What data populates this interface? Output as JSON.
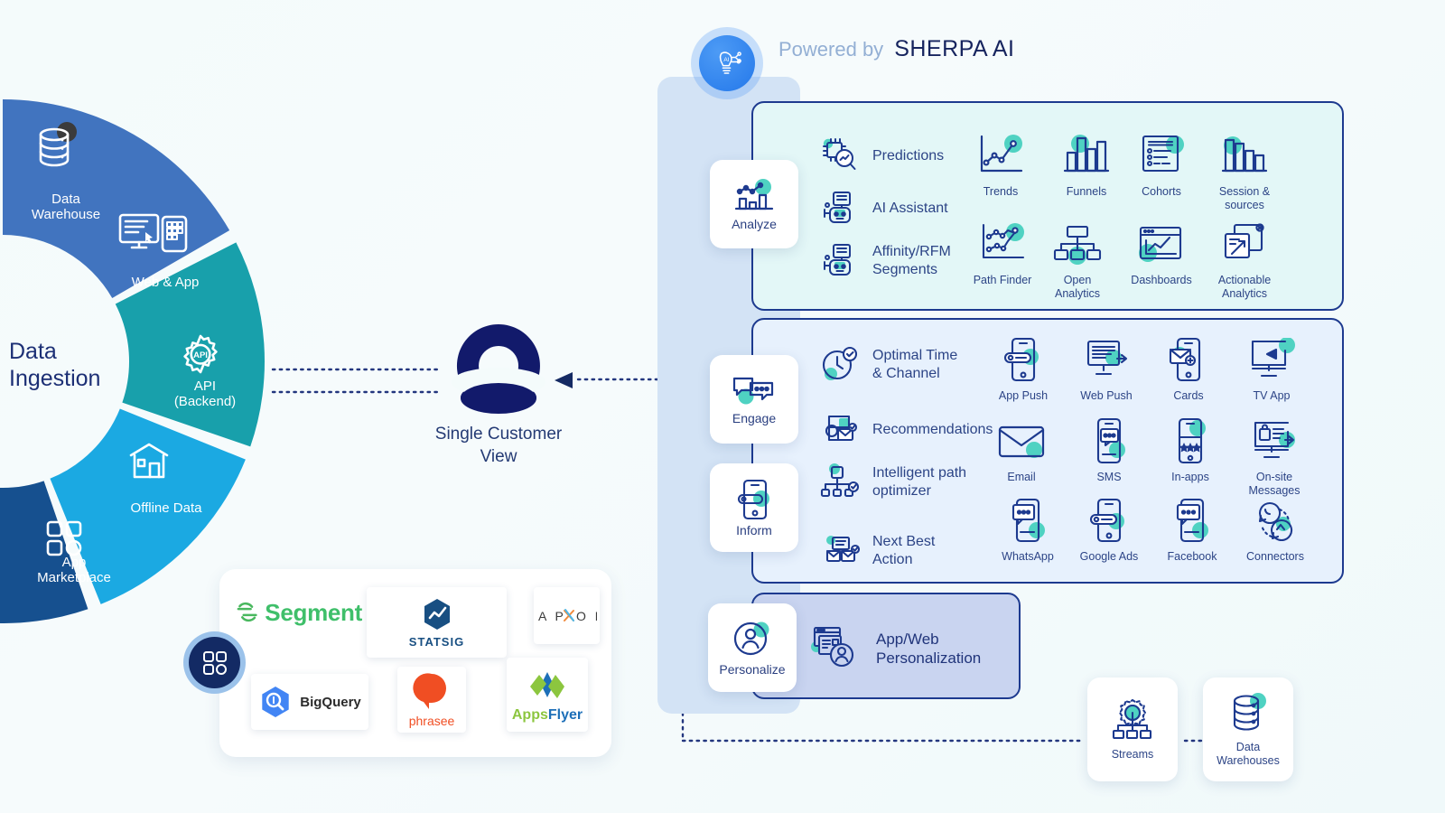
{
  "header": {
    "powered_by": "Powered by",
    "brand": "SHERPA AI",
    "badge_icon": "ai-lightbulb-icon"
  },
  "ingestion": {
    "title": "Data\nIngestion",
    "segments": [
      {
        "label": "Data\nWarehouse",
        "color": "#4174bf",
        "icon": "database-icon"
      },
      {
        "label": "Web & App",
        "color": "#18a0ab",
        "icon": "monitor-mobile-icon"
      },
      {
        "label": "API\n(Backend)",
        "color": "#1ba9e2",
        "icon": "api-gear-icon"
      },
      {
        "label": "Offline Data",
        "color": "#16508f",
        "icon": "store-icon"
      },
      {
        "label": "App\nMarketplace",
        "color": "#2b2f72",
        "icon": "grid-apps-icon"
      }
    ]
  },
  "scv": {
    "label": "Single\nCustomer View",
    "icon": "single-customer-view-icon"
  },
  "panels": {
    "analyze": {
      "stage_label": "Analyze",
      "stage_icon": "analyze-chart-icon",
      "features": [
        {
          "label": "Predictions",
          "icon": "predictions-chip-icon"
        },
        {
          "label": "AI Assistant",
          "icon": "ai-assistant-robot-icon"
        },
        {
          "label": "Affinity/RFM\nSegments",
          "icon": "affinity-rfm-robot-icon"
        }
      ],
      "tiles": [
        {
          "label": "Trends",
          "icon": "trends-linechart-icon"
        },
        {
          "label": "Funnels",
          "icon": "funnels-barchart-icon"
        },
        {
          "label": "Cohorts",
          "icon": "cohorts-list-icon"
        },
        {
          "label": "Session &\nsources",
          "icon": "session-sources-bars-icon"
        },
        {
          "label": "Path Finder",
          "icon": "path-finder-icon"
        },
        {
          "label": "Open\nAnalytics",
          "icon": "open-analytics-tree-icon"
        },
        {
          "label": "Dashboards",
          "icon": "dashboards-window-icon"
        },
        {
          "label": "Actionable\nAnalytics",
          "icon": "actionable-analytics-icon"
        }
      ]
    },
    "engage": {
      "stage_label": "Engage",
      "stage_icon": "engage-chat-icon",
      "inform_label": "Inform",
      "inform_icon": "inform-mobile-icon",
      "features": [
        {
          "label": "Optimal Time\n& Channel",
          "icon": "optimal-time-clock-icon"
        },
        {
          "label": "Recommendations",
          "icon": "recommendations-icon"
        },
        {
          "label": "Intelligent path\noptimizer",
          "icon": "intelligent-path-icon"
        },
        {
          "label": "Next Best\nAction",
          "icon": "next-best-action-icon"
        }
      ],
      "tiles": [
        {
          "label": "App Push",
          "icon": "app-push-icon"
        },
        {
          "label": "Web Push",
          "icon": "web-push-icon"
        },
        {
          "label": "Cards",
          "icon": "cards-icon"
        },
        {
          "label": "TV App",
          "icon": "tv-app-icon"
        },
        {
          "label": "Email",
          "icon": "email-envelope-icon"
        },
        {
          "label": "SMS",
          "icon": "sms-icon"
        },
        {
          "label": "In-apps",
          "icon": "in-apps-icon"
        },
        {
          "label": "On-site\nMessages",
          "icon": "on-site-messages-icon"
        },
        {
          "label": "WhatsApp",
          "icon": "whatsapp-icon"
        },
        {
          "label": "Google Ads",
          "icon": "google-ads-icon"
        },
        {
          "label": "Facebook",
          "icon": "facebook-icon"
        },
        {
          "label": "Connectors",
          "icon": "connectors-icon"
        }
      ]
    },
    "personalize": {
      "stage_label": "Personalize",
      "stage_icon": "personalize-avatar-icon",
      "item_label": "App/Web\nPersonalization",
      "item_icon": "app-web-personalization-icon"
    }
  },
  "outputs": [
    {
      "label": "Streams",
      "icon": "streams-icon"
    },
    {
      "label": "Data\nWarehouses",
      "icon": "data-warehouses-icon"
    }
  ],
  "partners": {
    "badge_icon": "app-marketplace-badge-icon",
    "logos": [
      {
        "name": "Segment",
        "text": "Segment",
        "icon": "segment-logo"
      },
      {
        "name": "Statsig",
        "text": "STATSIG",
        "icon": "statsig-logo"
      },
      {
        "name": "Apxor",
        "text": "APXOR",
        "icon": "apxor-logo"
      },
      {
        "name": "BigQuery",
        "text": "BigQuery",
        "icon": "bigquery-logo"
      },
      {
        "name": "Phrasee",
        "text": "phrasee",
        "icon": "phrasee-logo"
      },
      {
        "name": "AppsFlyer",
        "text": "AppsFlyer",
        "icon": "appsflyer-logo"
      }
    ]
  },
  "colors": {
    "navy": "#1d3a8f",
    "teal_accent": "#4fd2c2",
    "panel_analyze_bg": "#e3f7f7",
    "panel_engage_bg": "#e7f1fd",
    "panel_personalize_bg": "#c9d4f0",
    "rail_bg": "#d3e3f5",
    "brand_blue": "#2478ea"
  }
}
